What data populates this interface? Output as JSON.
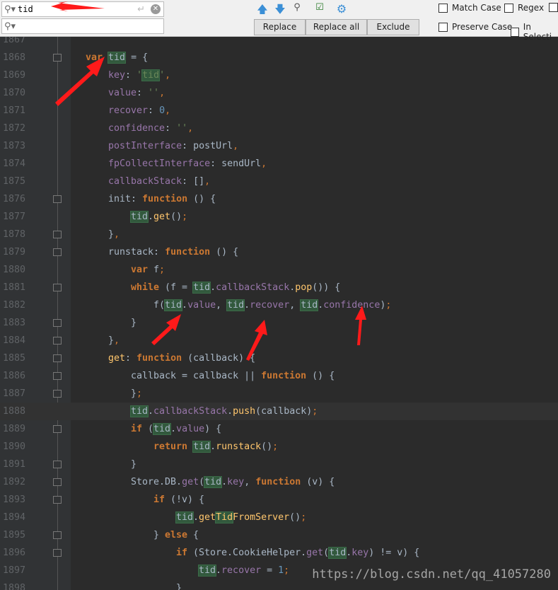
{
  "find": {
    "search_value": "tid",
    "replace_value": "",
    "enter_icon": "↵",
    "clear_icon": "✕"
  },
  "toolbar": {
    "replace": "Replace",
    "replace_all": "Replace all",
    "exclude": "Exclude",
    "match_case": "Match Case",
    "regex": "Regex",
    "preserve_case": "Preserve Case",
    "in_selection": "In Selecti"
  },
  "watermark": "https://blog.csdn.net/qq_41057280",
  "code": [
    {
      "n": "1867",
      "ind": 0,
      "t": []
    },
    {
      "n": "1868",
      "ind": 0,
      "fold": true,
      "t": [
        [
          "var",
          "k"
        ],
        [
          " "
        ],
        [
          "tid",
          "h"
        ],
        [
          " = {"
        ]
      ]
    },
    {
      "n": "1869",
      "ind": 4,
      "t": [
        [
          "key",
          "p"
        ],
        [
          ": "
        ],
        [
          "'",
          "s"
        ],
        [
          "tid",
          "s h"
        ],
        [
          "'",
          "s"
        ],
        [
          ",",
          "kc"
        ]
      ]
    },
    {
      "n": "1870",
      "ind": 4,
      "t": [
        [
          "value",
          "p"
        ],
        [
          ": "
        ],
        [
          "''",
          "s"
        ],
        [
          ",",
          "kc"
        ]
      ]
    },
    {
      "n": "1871",
      "ind": 4,
      "t": [
        [
          "recover",
          "p"
        ],
        [
          ": "
        ],
        [
          "0",
          "n"
        ],
        [
          ",",
          "kc"
        ]
      ]
    },
    {
      "n": "1872",
      "ind": 4,
      "t": [
        [
          "confidence",
          "p"
        ],
        [
          ": "
        ],
        [
          "''",
          "s"
        ],
        [
          ",",
          "kc"
        ]
      ]
    },
    {
      "n": "1873",
      "ind": 4,
      "t": [
        [
          "postInterface",
          "p"
        ],
        [
          ": postUrl"
        ],
        [
          ",",
          "kc"
        ]
      ]
    },
    {
      "n": "1874",
      "ind": 4,
      "t": [
        [
          "fpCollectInterface",
          "p"
        ],
        [
          ": sendUrl"
        ],
        [
          ",",
          "kc"
        ]
      ]
    },
    {
      "n": "1875",
      "ind": 4,
      "t": [
        [
          "callbackStack",
          "p"
        ],
        [
          ": []"
        ],
        [
          ",",
          "kc"
        ]
      ]
    },
    {
      "n": "1876",
      "ind": 4,
      "fold": true,
      "t": [
        [
          "init: "
        ],
        [
          "function",
          "k"
        ],
        [
          " () {"
        ]
      ]
    },
    {
      "n": "1877",
      "ind": 8,
      "t": [
        [
          "tid",
          "h"
        ],
        [
          "."
        ],
        [
          "get",
          "f"
        ],
        [
          "()"
        ],
        [
          ";",
          "kc"
        ]
      ]
    },
    {
      "n": "1878",
      "ind": 4,
      "fold": true,
      "t": [
        [
          "}"
        ],
        [
          ",",
          "kc"
        ]
      ]
    },
    {
      "n": "1879",
      "ind": 4,
      "fold": true,
      "t": [
        [
          "runstack"
        ],
        [
          ": "
        ],
        [
          "function",
          "k"
        ],
        [
          " () {"
        ]
      ]
    },
    {
      "n": "1880",
      "ind": 8,
      "t": [
        [
          "var",
          "k"
        ],
        [
          " f"
        ],
        [
          ";",
          "kc"
        ]
      ]
    },
    {
      "n": "1881",
      "ind": 8,
      "fold": true,
      "t": [
        [
          "while",
          "k"
        ],
        [
          " (f = "
        ],
        [
          "tid",
          "h"
        ],
        [
          "."
        ],
        [
          "callbackStack",
          "p"
        ],
        [
          "."
        ],
        [
          "pop",
          "f"
        ],
        [
          "()) {"
        ]
      ]
    },
    {
      "n": "1882",
      "ind": 12,
      "t": [
        [
          "f("
        ],
        [
          "tid",
          "h"
        ],
        [
          "."
        ],
        [
          "value",
          "p"
        ],
        [
          ", "
        ],
        [
          "tid",
          "h"
        ],
        [
          "."
        ],
        [
          "recover",
          "p"
        ],
        [
          ", "
        ],
        [
          "tid",
          "h"
        ],
        [
          "."
        ],
        [
          "confidence",
          "p"
        ],
        [
          ")"
        ],
        [
          ";",
          "kc"
        ]
      ]
    },
    {
      "n": "1883",
      "ind": 8,
      "fold": true,
      "t": [
        [
          "}"
        ]
      ]
    },
    {
      "n": "1884",
      "ind": 4,
      "fold": true,
      "t": [
        [
          "}"
        ],
        [
          ",",
          "kc"
        ]
      ]
    },
    {
      "n": "1885",
      "ind": 4,
      "fold": true,
      "t": [
        [
          "get",
          "f"
        ],
        [
          ": "
        ],
        [
          "function",
          "k"
        ],
        [
          " (callback) {"
        ]
      ]
    },
    {
      "n": "1886",
      "ind": 8,
      "fold": true,
      "t": [
        [
          "callback = callback || "
        ],
        [
          "function",
          "k"
        ],
        [
          " () {"
        ]
      ]
    },
    {
      "n": "1887",
      "ind": 8,
      "fold": true,
      "t": [
        [
          "}"
        ],
        [
          ";",
          "kc"
        ]
      ]
    },
    {
      "n": "1888",
      "ind": 8,
      "cur": true,
      "t": [
        [
          "tid",
          "h"
        ],
        [
          "."
        ],
        [
          "callbackStack",
          "p"
        ],
        [
          "."
        ],
        [
          "push",
          "f"
        ],
        [
          "(callback)"
        ],
        [
          ";",
          "kc"
        ]
      ]
    },
    {
      "n": "1889",
      "ind": 8,
      "fold": true,
      "t": [
        [
          "if",
          "k"
        ],
        [
          " ("
        ],
        [
          "tid",
          "h"
        ],
        [
          "."
        ],
        [
          "value",
          "p"
        ],
        [
          ") {"
        ]
      ]
    },
    {
      "n": "1890",
      "ind": 12,
      "t": [
        [
          "return",
          "k"
        ],
        [
          " "
        ],
        [
          "tid",
          "h"
        ],
        [
          "."
        ],
        [
          "runstack",
          "f"
        ],
        [
          "()"
        ],
        [
          ";",
          "kc"
        ]
      ]
    },
    {
      "n": "1891",
      "ind": 8,
      "fold": true,
      "t": [
        [
          "}"
        ]
      ]
    },
    {
      "n": "1892",
      "ind": 8,
      "fold": true,
      "t": [
        [
          "Store.DB."
        ],
        [
          "get",
          "p"
        ],
        [
          "("
        ],
        [
          "tid",
          "h"
        ],
        [
          "."
        ],
        [
          "key",
          "p"
        ],
        [
          ", "
        ],
        [
          "function",
          "k"
        ],
        [
          " (v) {"
        ]
      ]
    },
    {
      "n": "1893",
      "ind": 12,
      "fold": true,
      "t": [
        [
          "if",
          "k"
        ],
        [
          " (!v) {"
        ]
      ]
    },
    {
      "n": "1894",
      "ind": 16,
      "t": [
        [
          "tid",
          "h"
        ],
        [
          "."
        ],
        [
          "get",
          "f"
        ],
        [
          "Tid",
          "f h"
        ],
        [
          "FromServer",
          "f"
        ],
        [
          "()"
        ],
        [
          ";",
          "kc"
        ]
      ]
    },
    {
      "n": "1895",
      "ind": 12,
      "fold": true,
      "t": [
        [
          "} "
        ],
        [
          "else",
          "k"
        ],
        [
          " {"
        ]
      ]
    },
    {
      "n": "1896",
      "ind": 16,
      "fold": true,
      "t": [
        [
          "if",
          "k"
        ],
        [
          " (Store.CookieHelper."
        ],
        [
          "get",
          "p"
        ],
        [
          "("
        ],
        [
          "tid",
          "h"
        ],
        [
          "."
        ],
        [
          "key",
          "p"
        ],
        [
          ") != v) {"
        ]
      ]
    },
    {
      "n": "1897",
      "ind": 20,
      "t": [
        [
          "tid",
          "h"
        ],
        [
          "."
        ],
        [
          "recover",
          "p"
        ],
        [
          " = "
        ],
        [
          "1",
          "n"
        ],
        [
          ";",
          "kc"
        ]
      ]
    },
    {
      "n": "1898",
      "ind": 16,
      "t": [
        [
          "}"
        ]
      ]
    }
  ]
}
